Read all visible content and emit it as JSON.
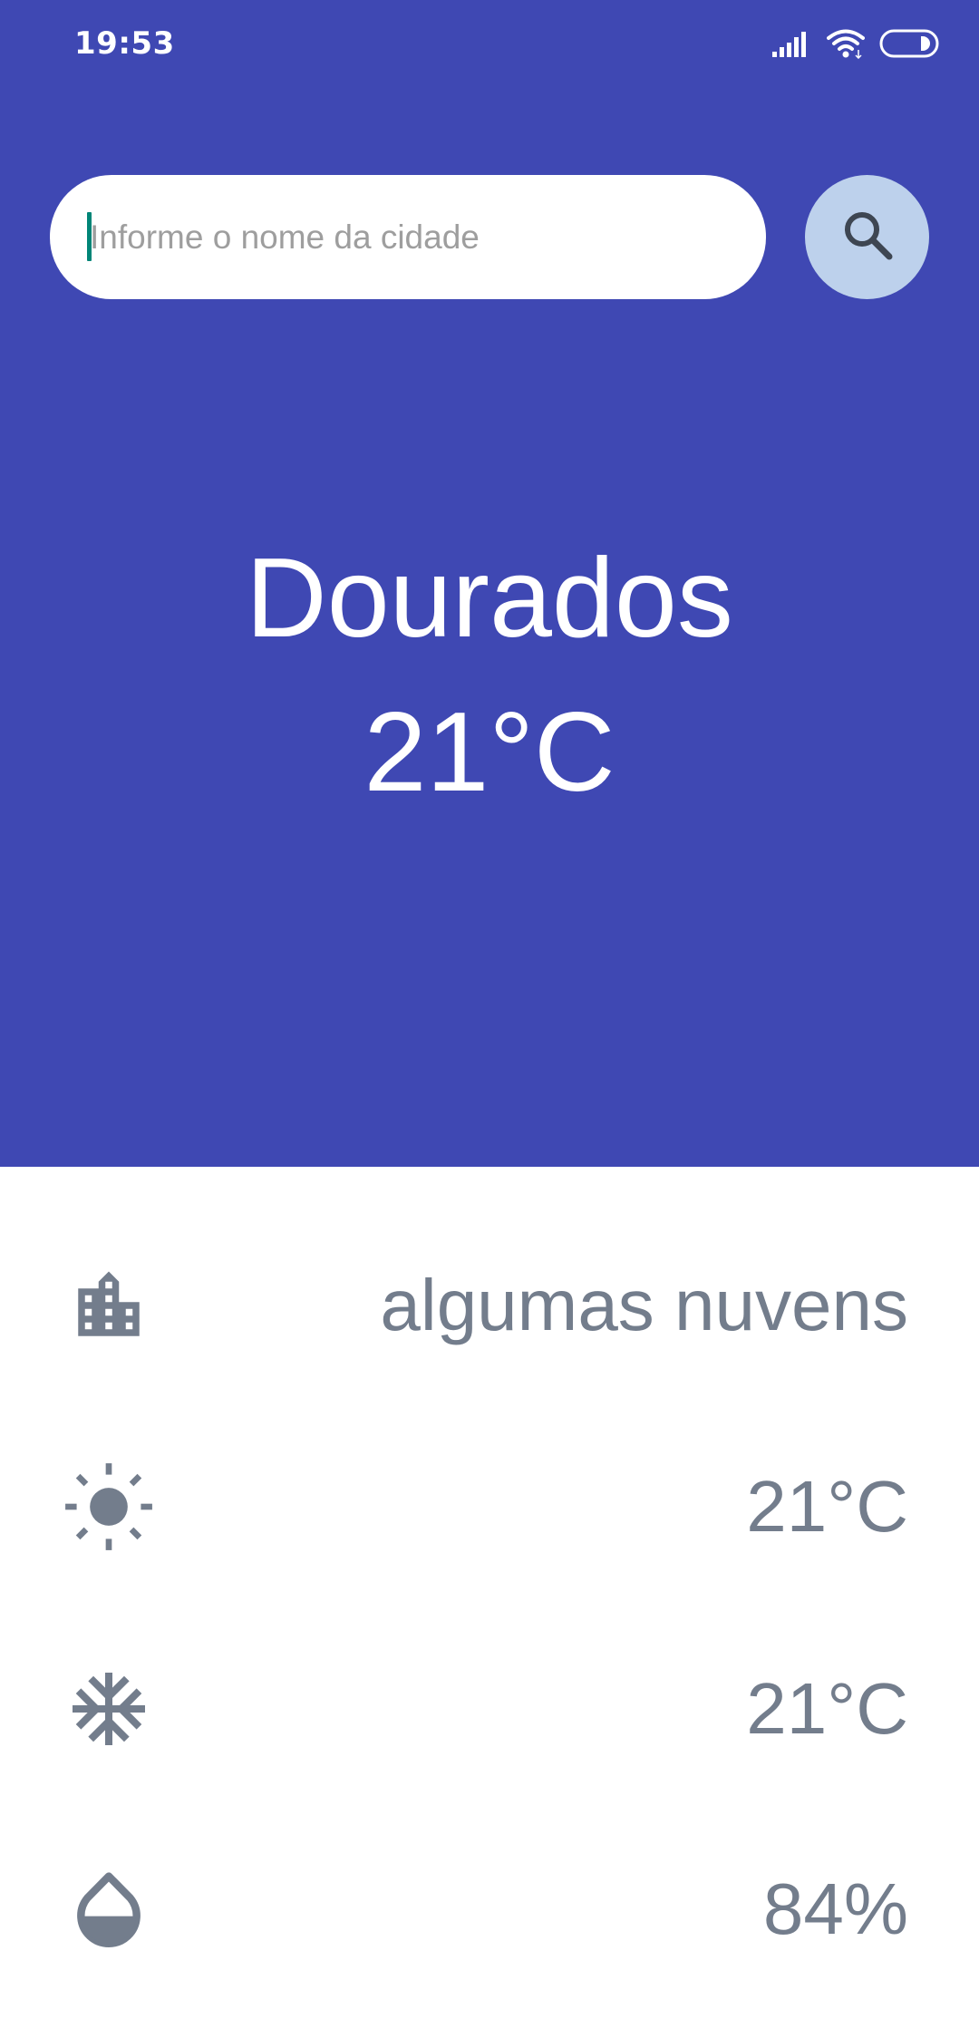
{
  "status_bar": {
    "time": "19:53",
    "icons": [
      "signal-icon",
      "wifi-icon",
      "battery-icon"
    ]
  },
  "search": {
    "placeholder": "Informe o nome da cidade",
    "value": "",
    "button_icon": "search-icon"
  },
  "current": {
    "city": "Dourados",
    "temperature": "21°C"
  },
  "details": {
    "description": {
      "icon": "city-icon",
      "value": "algumas nuvens"
    },
    "max_temp": {
      "icon": "sun-icon",
      "value": "21°C"
    },
    "min_temp": {
      "icon": "snowflake-icon",
      "value": "21°C"
    },
    "humidity": {
      "icon": "water-drop-icon",
      "value": "84%"
    }
  },
  "colors": {
    "header_background": "#3F48B3",
    "search_button_background": "#BDD1EC",
    "detail_text": "#737D8C",
    "caret": "#008577"
  }
}
